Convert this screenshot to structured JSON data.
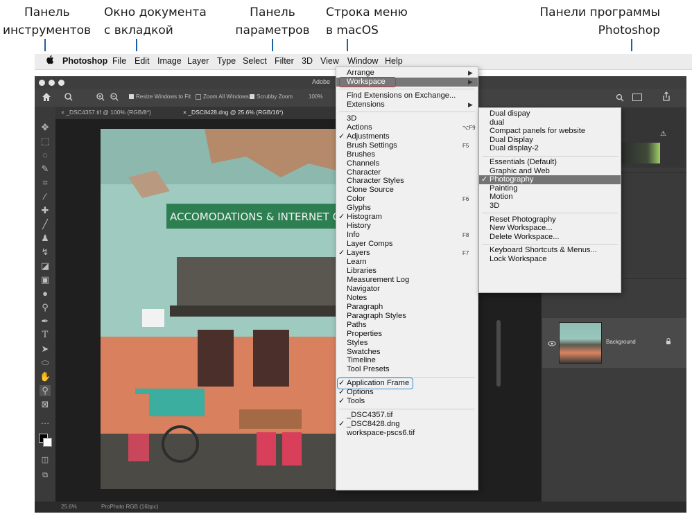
{
  "annotations": {
    "tools_panel": [
      "Панель",
      "инструментов"
    ],
    "document_window": [
      "Окно документа",
      "с вкладкой"
    ],
    "options_panel": [
      "Панель",
      "параметров"
    ],
    "menu_bar": [
      "Строка меню",
      "в macOS"
    ],
    "program_panels": [
      "Панели программы",
      "Photoshop"
    ]
  },
  "menubar": {
    "apple": "",
    "app": "Photoshop",
    "items": [
      "File",
      "Edit",
      "Image",
      "Layer",
      "Type",
      "Select",
      "Filter",
      "3D",
      "View",
      "Window",
      "Help"
    ]
  },
  "app": {
    "title_fragment": "Adobe",
    "options_bar": {
      "resize_windows": "Resize Windows to Fit",
      "zoom_all": "Zoom All Windows",
      "scrubby_zoom": "Scrubby Zoom",
      "zoom_value": "100%"
    },
    "tabs": [
      "_DSC4357.tif @ 100% (RGB/8*)",
      "_DSC8428.dng @ 25.6% (RGB/16*)"
    ],
    "status": {
      "zoom": "25.6%",
      "profile": "ProPhoto RGB (16bpc)"
    },
    "layers": {
      "background": "Background"
    },
    "photo_sign": "ACCOMODATIONS & INTERNET CAFE"
  },
  "window_menu": {
    "items": [
      {
        "label": "Arrange",
        "submenu": true
      },
      {
        "label": "Workspace",
        "submenu": true,
        "highlighted": true
      },
      {
        "separator": true
      },
      {
        "label": "Find Extensions on Exchange..."
      },
      {
        "label": "Extensions",
        "submenu": true
      },
      {
        "separator": true
      },
      {
        "label": "3D"
      },
      {
        "label": "Actions",
        "shortcut": "⌥F9"
      },
      {
        "label": "Adjustments",
        "checked": true
      },
      {
        "label": "Brush Settings",
        "shortcut": "F5"
      },
      {
        "label": "Brushes"
      },
      {
        "label": "Channels"
      },
      {
        "label": "Character"
      },
      {
        "label": "Character Styles"
      },
      {
        "label": "Clone Source"
      },
      {
        "label": "Color",
        "shortcut": "F6"
      },
      {
        "label": "Glyphs"
      },
      {
        "label": "Histogram",
        "checked": true
      },
      {
        "label": "History"
      },
      {
        "label": "Info",
        "shortcut": "F8"
      },
      {
        "label": "Layer Comps"
      },
      {
        "label": "Layers",
        "checked": true,
        "shortcut": "F7"
      },
      {
        "label": "Learn"
      },
      {
        "label": "Libraries"
      },
      {
        "label": "Measurement Log"
      },
      {
        "label": "Navigator"
      },
      {
        "label": "Notes"
      },
      {
        "label": "Paragraph"
      },
      {
        "label": "Paragraph Styles"
      },
      {
        "label": "Paths"
      },
      {
        "label": "Properties"
      },
      {
        "label": "Styles"
      },
      {
        "label": "Swatches"
      },
      {
        "label": "Timeline"
      },
      {
        "label": "Tool Presets"
      },
      {
        "separator": true
      },
      {
        "label": "Application Frame",
        "checked": true,
        "outlined": true
      },
      {
        "label": "Options",
        "checked": true
      },
      {
        "label": "Tools",
        "checked": true
      },
      {
        "separator": true
      },
      {
        "label": "_DSC4357.tif"
      },
      {
        "label": "_DSC8428.dng",
        "checked": true
      },
      {
        "label": "workspace-pscs6.tif"
      }
    ]
  },
  "workspace_menu": {
    "items": [
      {
        "label": "Dual dispay"
      },
      {
        "label": "dual"
      },
      {
        "label": "Compact panels for website"
      },
      {
        "label": "Dual Display"
      },
      {
        "label": "Dual display-2"
      },
      {
        "separator": true
      },
      {
        "label": "Essentials (Default)"
      },
      {
        "label": "Graphic and Web"
      },
      {
        "label": "Photography",
        "checked": true,
        "selected": true
      },
      {
        "label": "Painting"
      },
      {
        "label": "Motion"
      },
      {
        "label": "3D"
      },
      {
        "separator": true
      },
      {
        "label": "Reset Photography"
      },
      {
        "label": "New Workspace..."
      },
      {
        "label": "Delete Workspace..."
      },
      {
        "separator": true
      },
      {
        "label": "Keyboard Shortcuts & Menus..."
      },
      {
        "label": "Lock Workspace"
      }
    ]
  },
  "colors": {
    "annotation_leader": "#1e5fa0",
    "highlight_red": "#d0312d",
    "highlight_blue": "#2a8fd6",
    "ui_dark": "#2f2f2f"
  }
}
